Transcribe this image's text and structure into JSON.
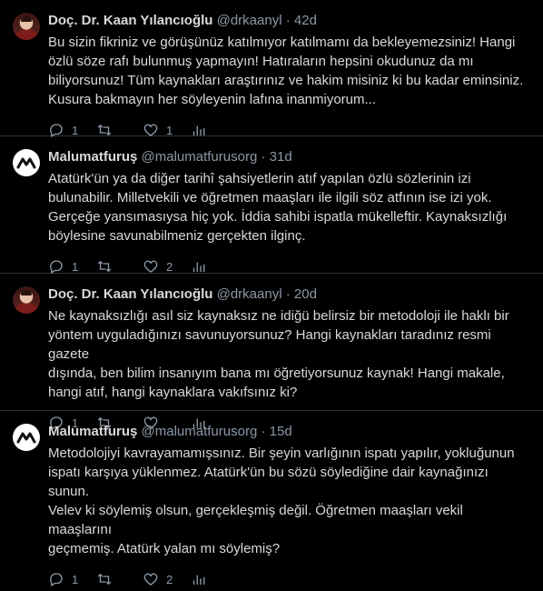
{
  "colors": {
    "background": "#000000",
    "text": "#d9d9d9",
    "muted": "#8b98a5",
    "divider": "#2f3336"
  },
  "tweets": [
    {
      "name": "Doç. Dr. Kaan Yılancıoğlu",
      "handle": "@drkaanyl",
      "separator": "·",
      "time": "42d",
      "avatar": "person-photo",
      "text": "Bu sizin fikriniz ve görüşünüz katılmıyor katılmamı da bekleyemezsiniz! Hangi\nözlü söze rafı bulunmuş yapmayın! Hatıraların hepsini okudunuz da mı\nbiliyorsunuz! Tüm kaynakları araştırınız ve hakim misiniz ki bu kadar eminsiniz.\nKusura bakmayın her söyleyenin lafına inanmiyorum...",
      "reply_count": "1",
      "retweet_count": "",
      "like_count": "1"
    },
    {
      "name": "Malumatfuruş",
      "handle": "@malumatfurusorg",
      "separator": "·",
      "time": "31d",
      "avatar": "malumatfurus-logo",
      "text": "Atatürk'ün ya da diğer tarihî şahsiyetlerin atıf yapılan özlü sözlerinin izi\nbulunabilir. Milletvekili ve öğretmen maaşları ile ilgili söz atfının ise izi yok.\nGerçeğe yansımasıysa hiç yok. İddia sahibi ispatla mükelleftir. Kaynaksızlığı\nböylesine savunabilmeniz gerçekten ilginç.",
      "reply_count": "1",
      "retweet_count": "",
      "like_count": "2"
    },
    {
      "name": "Doç. Dr. Kaan Yılancıoğlu",
      "handle": "@drkaanyl",
      "separator": "·",
      "time": "20d",
      "avatar": "person-photo",
      "text": "Ne kaynaksızlığı asıl siz kaynaksız ne idiğü belirsiz bir metodoloji ile haklı bir\nyöntem uyguladığınızı savunuyorsunuz? Hangi kaynakları taradınız resmi gazete\ndışında, ben bilim insanıyım bana mı öğretiyorsunuz kaynak! Hangi makale,\nhangi atıf, hangi kaynaklara vakıfsınız ki?",
      "reply_count": "1",
      "retweet_count": "",
      "like_count": ""
    },
    {
      "name": "Malumatfuruş",
      "handle": "@malumatfurusorg",
      "separator": "·",
      "time": "15d",
      "avatar": "malumatfurus-logo",
      "text": "Metodolojiyi kavrayamamışsınız. Bir şeyin varlığının ispatı yapılır, yokluğunun\nispatı karşıya yüklenmez. Atatürk'ün bu sözü söylediğine dair kaynağınızı sunun.\nVelev ki söylemiş olsun, gerçekleşmiş değil. Öğretmen maaşları vekil maaşlarını\ngeçmemiş. Atatürk yalan mı söylemiş?",
      "reply_count": "1",
      "retweet_count": "",
      "like_count": "2"
    }
  ]
}
